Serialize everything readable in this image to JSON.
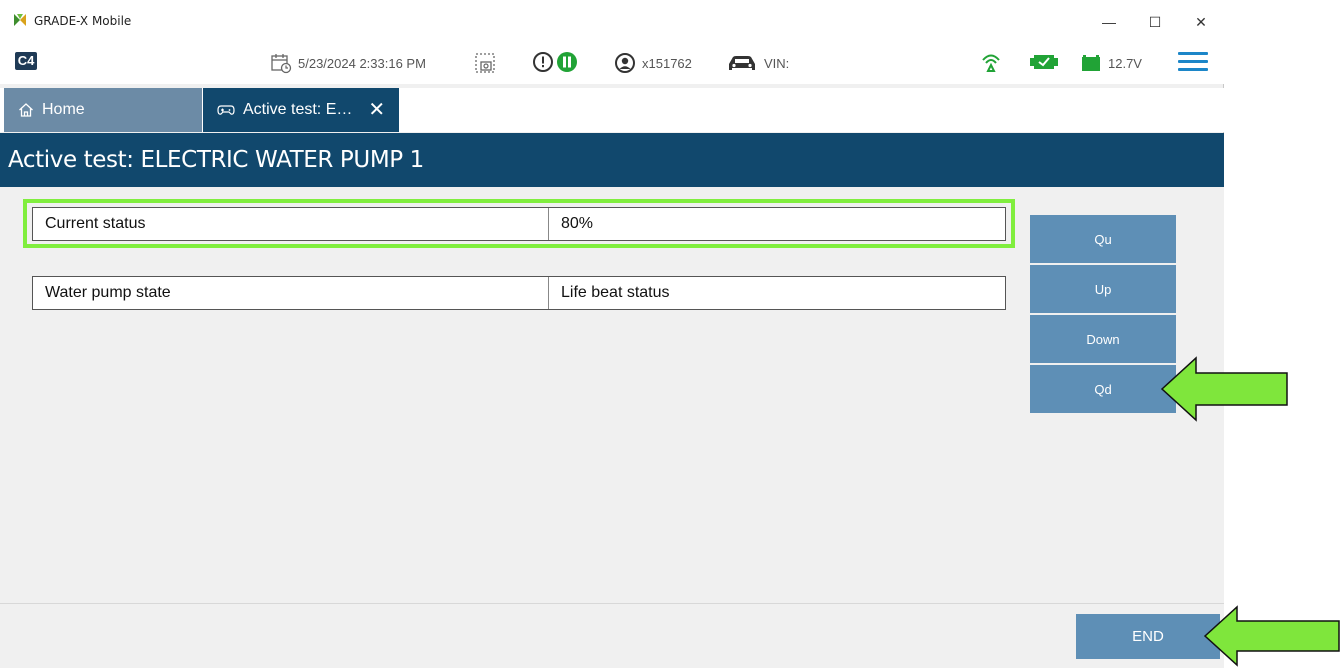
{
  "window": {
    "title": "GRADE-X Mobile",
    "controls": {
      "minimize": "—",
      "maximize": "☐",
      "close": "✕"
    }
  },
  "statusbar": {
    "logo": "C4",
    "datetime": "5/23/2024 2:33:16 PM",
    "user": "x151762",
    "vin_label": "VIN:",
    "battery_voltage": "12.7V",
    "icons": [
      "calendar-clock-icon",
      "screenshot-icon",
      "alert-icon",
      "pause-icon",
      "user-icon",
      "car-icon",
      "wifi-signal-icon",
      "vci-icon",
      "battery-icon",
      "menu-icon"
    ]
  },
  "tabs": {
    "home": "Home",
    "active": "Active test: E…",
    "close": "✕"
  },
  "page": {
    "title": "Active test: ELECTRIC WATER PUMP 1"
  },
  "rows": [
    {
      "label": "Current status",
      "value": "80%"
    },
    {
      "label": "Water pump state",
      "value": "Life beat status"
    }
  ],
  "buttons": {
    "qu": "Qu",
    "up": "Up",
    "down": "Down",
    "qd": "Qd",
    "end": "END"
  },
  "colors": {
    "header_bg": "#11486d",
    "home_tab_bg": "#6c8ba6",
    "button_bg": "#5e8fb6",
    "highlight": "#80ee3e",
    "arrow_fill": "#7fe63c",
    "status_green": "#21a336",
    "menu_blue": "#1c86c8"
  }
}
